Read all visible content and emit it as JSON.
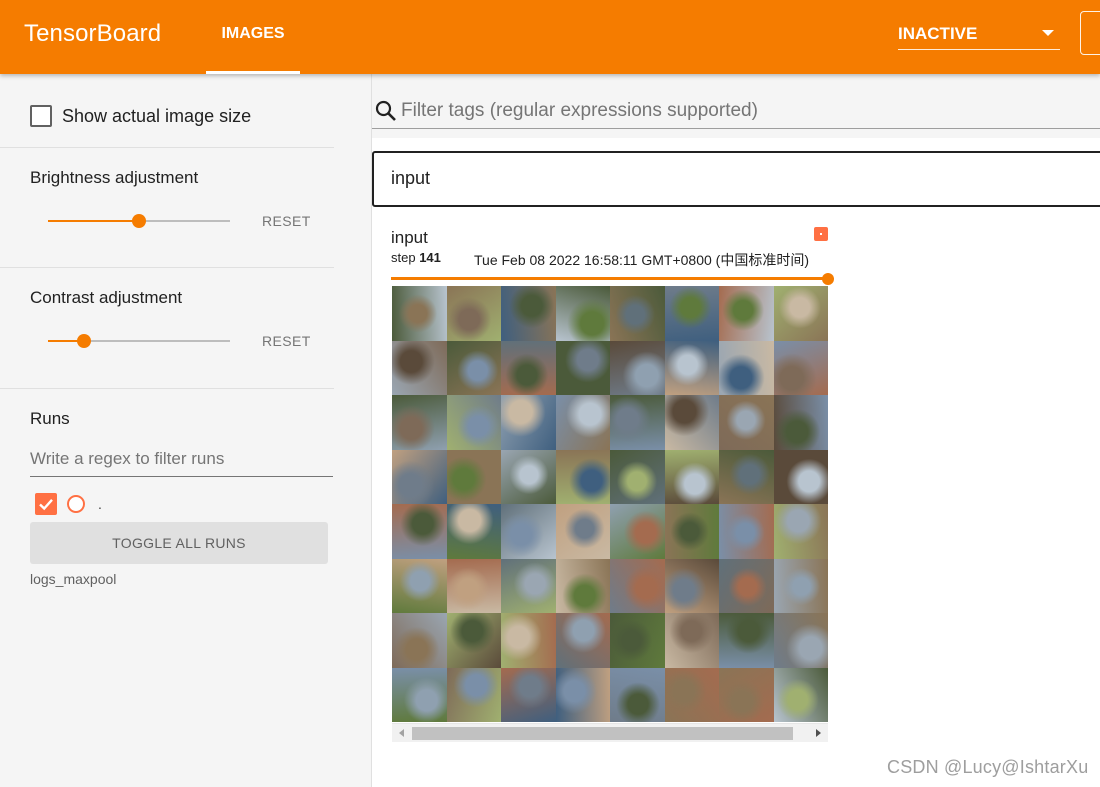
{
  "header": {
    "brand": "TensorBoard",
    "tab_images": "IMAGES",
    "status_select": "INACTIVE",
    "accent_color": "#f57c00"
  },
  "sidebar": {
    "show_actual_size_label": "Show actual image size",
    "show_actual_size_checked": false,
    "brightness": {
      "title": "Brightness adjustment",
      "value": 0.5,
      "reset": "RESET"
    },
    "contrast": {
      "title": "Contrast adjustment",
      "value": 0.2,
      "reset": "RESET"
    },
    "runs": {
      "title": "Runs",
      "filter_placeholder": "Write a regex to filter runs",
      "items": [
        {
          "name": ".",
          "checked": true,
          "color": "#ff7043"
        }
      ],
      "toggle_all": "TOGGLE ALL RUNS",
      "log_dir": "logs_maxpool"
    }
  },
  "main": {
    "filter_placeholder": "Filter tags (regular expressions supported)",
    "tag_group": "input",
    "card": {
      "title": "input",
      "step_label": "step",
      "step_value": "141",
      "timestamp": "Tue Feb 08 2022 16:58:11 GMT+0800 (中国标准时间)",
      "step_progress": 1.0,
      "image_grid": {
        "rows": 8,
        "cols": 8
      }
    }
  },
  "watermark": "CSDN @Lucy@IshtarXu"
}
